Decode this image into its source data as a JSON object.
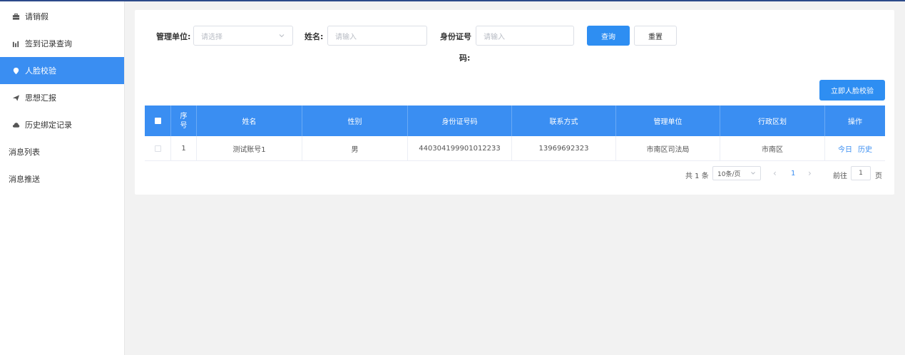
{
  "sidebar": {
    "items": [
      {
        "label": "请销假",
        "icon": "briefcase-icon"
      },
      {
        "label": "签到记录查询",
        "icon": "bar-chart-icon"
      },
      {
        "label": "人脸校验",
        "icon": "location-pin-icon",
        "active": true
      },
      {
        "label": "思想汇报",
        "icon": "send-icon"
      },
      {
        "label": "历史绑定记录",
        "icon": "cloud-icon"
      },
      {
        "label": "消息列表"
      },
      {
        "label": "消息推送"
      }
    ]
  },
  "filters": {
    "unit_label": "管理单位:",
    "unit_placeholder": "请选择",
    "name_label": "姓名:",
    "name_placeholder": "请输入",
    "id_label_line1": "身份证号",
    "id_label_line2": "码:",
    "id_placeholder": "请输入",
    "query_button": "查询",
    "reset_button": "重置"
  },
  "action": {
    "face_verify_button": "立即人脸校验"
  },
  "table": {
    "headers": {
      "index_line1": "序",
      "index_line2": "号",
      "name": "姓名",
      "gender": "性别",
      "id_number": "身份证号码",
      "contact": "联系方式",
      "unit": "管理单位",
      "district": "行政区划",
      "operation": "操作"
    },
    "rows": [
      {
        "index": "1",
        "name": "测试账号1",
        "gender": "男",
        "id_number": "440304199901012233",
        "contact": "13969692323",
        "unit": "市南区司法局",
        "district": "市南区",
        "op_today": "今日",
        "op_history": "历史"
      }
    ]
  },
  "pagination": {
    "total": "共 1 条",
    "page_size": "10条/页",
    "prev": "‹",
    "current_page": "1",
    "next": "›",
    "goto_label": "前往",
    "goto_value": "1",
    "page_suffix": "页"
  },
  "colors": {
    "primary": "#3a8ef2",
    "table_header": "#3a8ef2"
  }
}
